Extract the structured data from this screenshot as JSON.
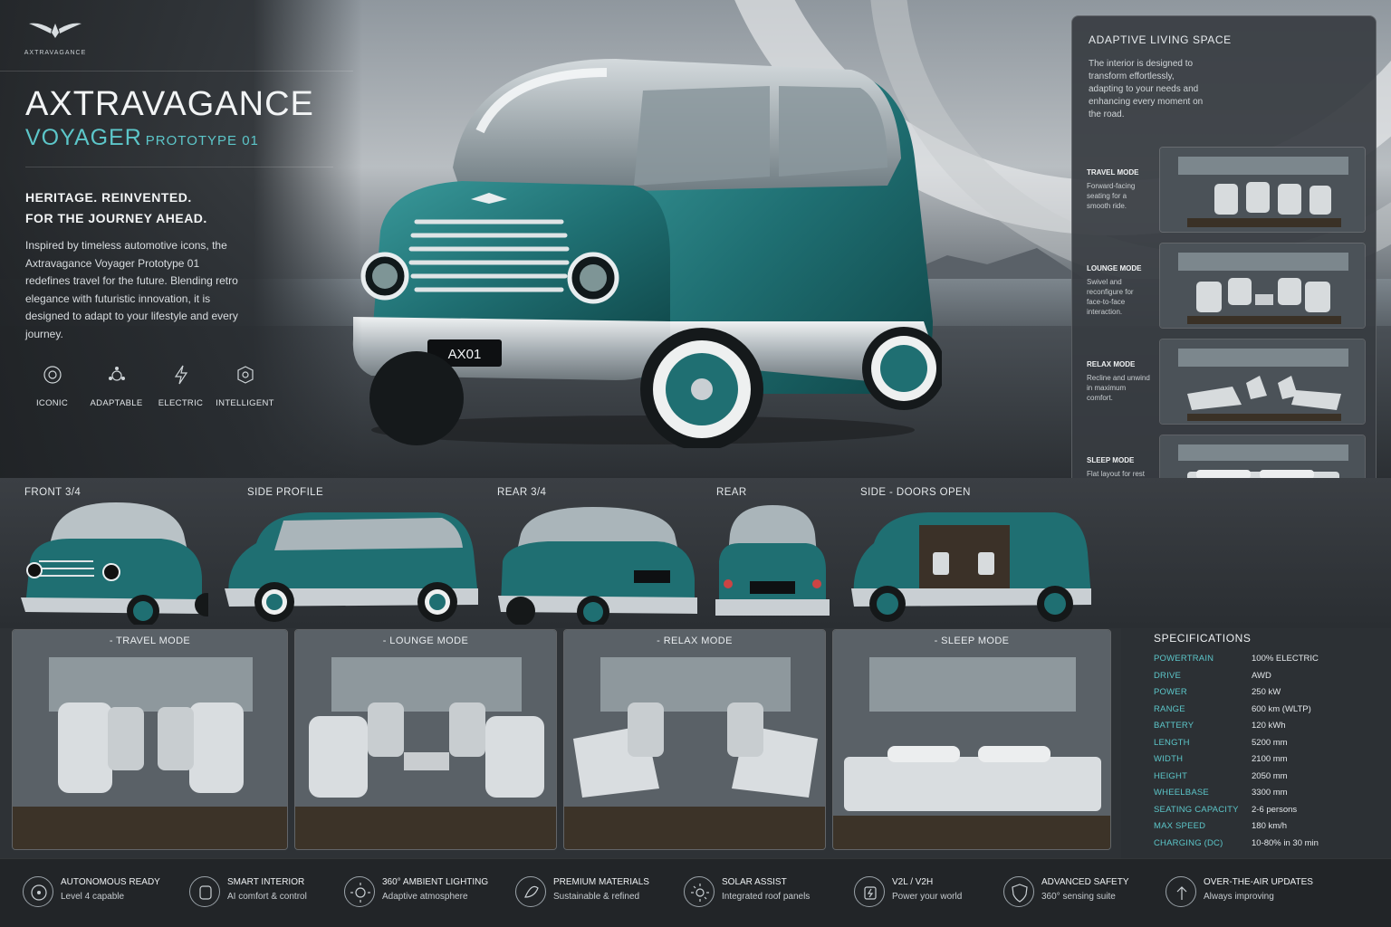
{
  "brand": {
    "logo_text": "AXTRAVAGANCE"
  },
  "hero": {
    "title": "AXTRAVAGANCE",
    "subtitle": "VOYAGER",
    "subtitle_small": "PROTOTYPE 01",
    "tagline_1": "HERITAGE. REINVENTED.",
    "tagline_2": "FOR THE JOURNEY AHEAD.",
    "intro": "Inspired by timeless automotive icons, the Axtravagance Voyager Prototype 01 redefines travel for the future. Blending retro elegance with futuristic innovation, it is designed to adapt to your lifestyle and every journey.",
    "plate": "AX01",
    "features": [
      {
        "label": "ICONIC",
        "icon": "iconic-icon"
      },
      {
        "label": "ADAPTABLE",
        "icon": "adaptable-icon"
      },
      {
        "label": "ELECTRIC",
        "icon": "electric-icon"
      },
      {
        "label": "INTELLIGENT",
        "icon": "intelligent-icon"
      }
    ]
  },
  "living_space": {
    "title": "ADAPTIVE LIVING SPACE",
    "description": "The interior is designed to transform effortlessly, adapting to your needs and enhancing every moment on the road.",
    "modes": [
      {
        "title": "TRAVEL MODE",
        "desc": "Forward-facing seating for a smooth ride."
      },
      {
        "title": "LOUNGE MODE",
        "desc": "Swivel and reconfigure for face-to-face interaction."
      },
      {
        "title": "RELAX MODE",
        "desc": "Recline and unwind in maximum comfort."
      },
      {
        "title": "SLEEP MODE",
        "desc": "Flat layout for rest anywhere, anytime."
      }
    ]
  },
  "views": [
    {
      "label": "FRONT 3/4"
    },
    {
      "label": "SIDE PROFILE"
    },
    {
      "label": "REAR 3/4"
    },
    {
      "label": "REAR"
    },
    {
      "label": "SIDE - DOORS OPEN"
    }
  ],
  "interiors": [
    {
      "title": "- TRAVEL MODE"
    },
    {
      "title": "- LOUNGE MODE"
    },
    {
      "title": "- RELAX MODE"
    },
    {
      "title": "- SLEEP MODE"
    }
  ],
  "specifications": {
    "title": "SPECIFICATIONS",
    "rows": [
      {
        "k": "POWERTRAIN",
        "v": "100% ELECTRIC"
      },
      {
        "k": "DRIVE",
        "v": "AWD"
      },
      {
        "k": "POWER",
        "v": "250 kW"
      },
      {
        "k": "RANGE",
        "v": "600 km (WLTP)"
      },
      {
        "k": "BATTERY",
        "v": "120 kWh"
      },
      {
        "k": "LENGTH",
        "v": "5200 mm"
      },
      {
        "k": "WIDTH",
        "v": "2100 mm"
      },
      {
        "k": "HEIGHT",
        "v": "2050 mm"
      },
      {
        "k": "WHEELBASE",
        "v": "3300 mm"
      },
      {
        "k": "SEATING CAPACITY",
        "v": "2-6 persons"
      },
      {
        "k": "MAX SPEED",
        "v": "180 km/h"
      },
      {
        "k": "CHARGING (DC)",
        "v": "10-80% in 30 min"
      }
    ]
  },
  "footer": [
    {
      "title": "AUTONOMOUS READY",
      "sub": "Level 4 capable",
      "icon": "autonomous-icon"
    },
    {
      "title": "SMART INTERIOR",
      "sub": "AI comfort & control",
      "icon": "smart-interior-icon"
    },
    {
      "title": "360° AMBIENT LIGHTING",
      "sub": "Adaptive atmosphere",
      "icon": "ambient-lighting-icon"
    },
    {
      "title": "PREMIUM MATERIALS",
      "sub": "Sustainable & refined",
      "icon": "materials-icon"
    },
    {
      "title": "SOLAR ASSIST",
      "sub": "Integrated roof panels",
      "icon": "solar-icon"
    },
    {
      "title": "V2L / V2H",
      "sub": "Power your world",
      "icon": "v2l-icon"
    },
    {
      "title": "ADVANCED SAFETY",
      "sub": "360° sensing suite",
      "icon": "safety-icon"
    },
    {
      "title": "OVER-THE-AIR UPDATES",
      "sub": "Always improving",
      "icon": "ota-icon"
    }
  ],
  "colors": {
    "accent": "#5cc6c9",
    "body_teal": "#1f6f72",
    "chrome": "#c9cfd3",
    "background": "#24272b"
  }
}
